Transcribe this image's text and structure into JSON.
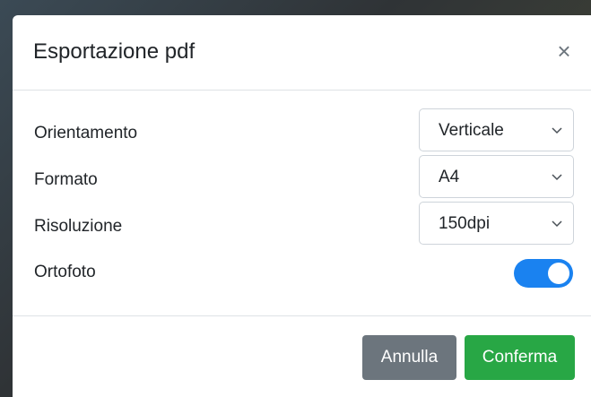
{
  "dialog": {
    "title": "Esportazione pdf",
    "close_label": "×"
  },
  "fields": {
    "orientation": {
      "label": "Orientamento",
      "value": "Verticale"
    },
    "format": {
      "label": "Formato",
      "value": "A4"
    },
    "resolution": {
      "label": "Risoluzione",
      "value": "150dpi"
    },
    "orthophoto": {
      "label": "Ortofoto",
      "enabled": true
    }
  },
  "footer": {
    "cancel_label": "Annulla",
    "confirm_label": "Conferma"
  },
  "colors": {
    "toggle_on": "#1a82f0",
    "cancel_bg": "#6c757d",
    "confirm_bg": "#28a745"
  }
}
